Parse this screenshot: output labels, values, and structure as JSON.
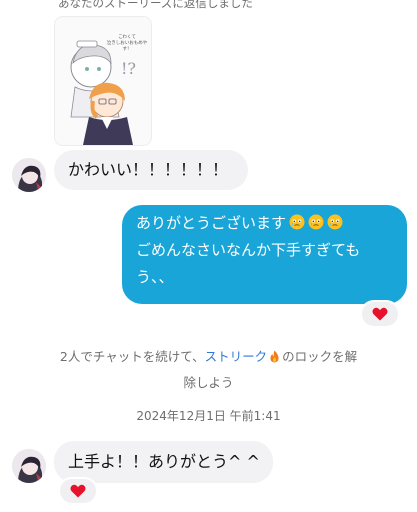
{
  "story_reply_label": "あなたのストーリーズに返信しました",
  "story_thumbnail": {
    "caption": "こわくて\n泣きしおいおもめやす！",
    "mark": "!?"
  },
  "messages": {
    "incoming_1": {
      "text": "かわいい！！！！！！"
    },
    "outgoing_1": {
      "line1": "ありがとうございます",
      "line2": "ごめんなさいなんか下手すぎても",
      "line3": "う、、",
      "emojis": [
        "face-holding-back-tears",
        "face-holding-back-tears",
        "face-holding-back-tears"
      ],
      "reaction": "heart"
    },
    "incoming_2": {
      "text": "上手よ！！ありがとう^ ^",
      "reaction": "heart"
    }
  },
  "streak_notice": {
    "prefix": "2人でチャットを続けて、",
    "streak_link": "ストリーク",
    "suffix": "のロックを解",
    "line2": "除しよう"
  },
  "timestamp": "2024年12月1日 午前1:41",
  "colors": {
    "outgoing_bubble": "#1aa5d8",
    "incoming_bubble": "#f2f2f4",
    "heart": "#e8112d",
    "streak_link": "#2f7ad8"
  }
}
